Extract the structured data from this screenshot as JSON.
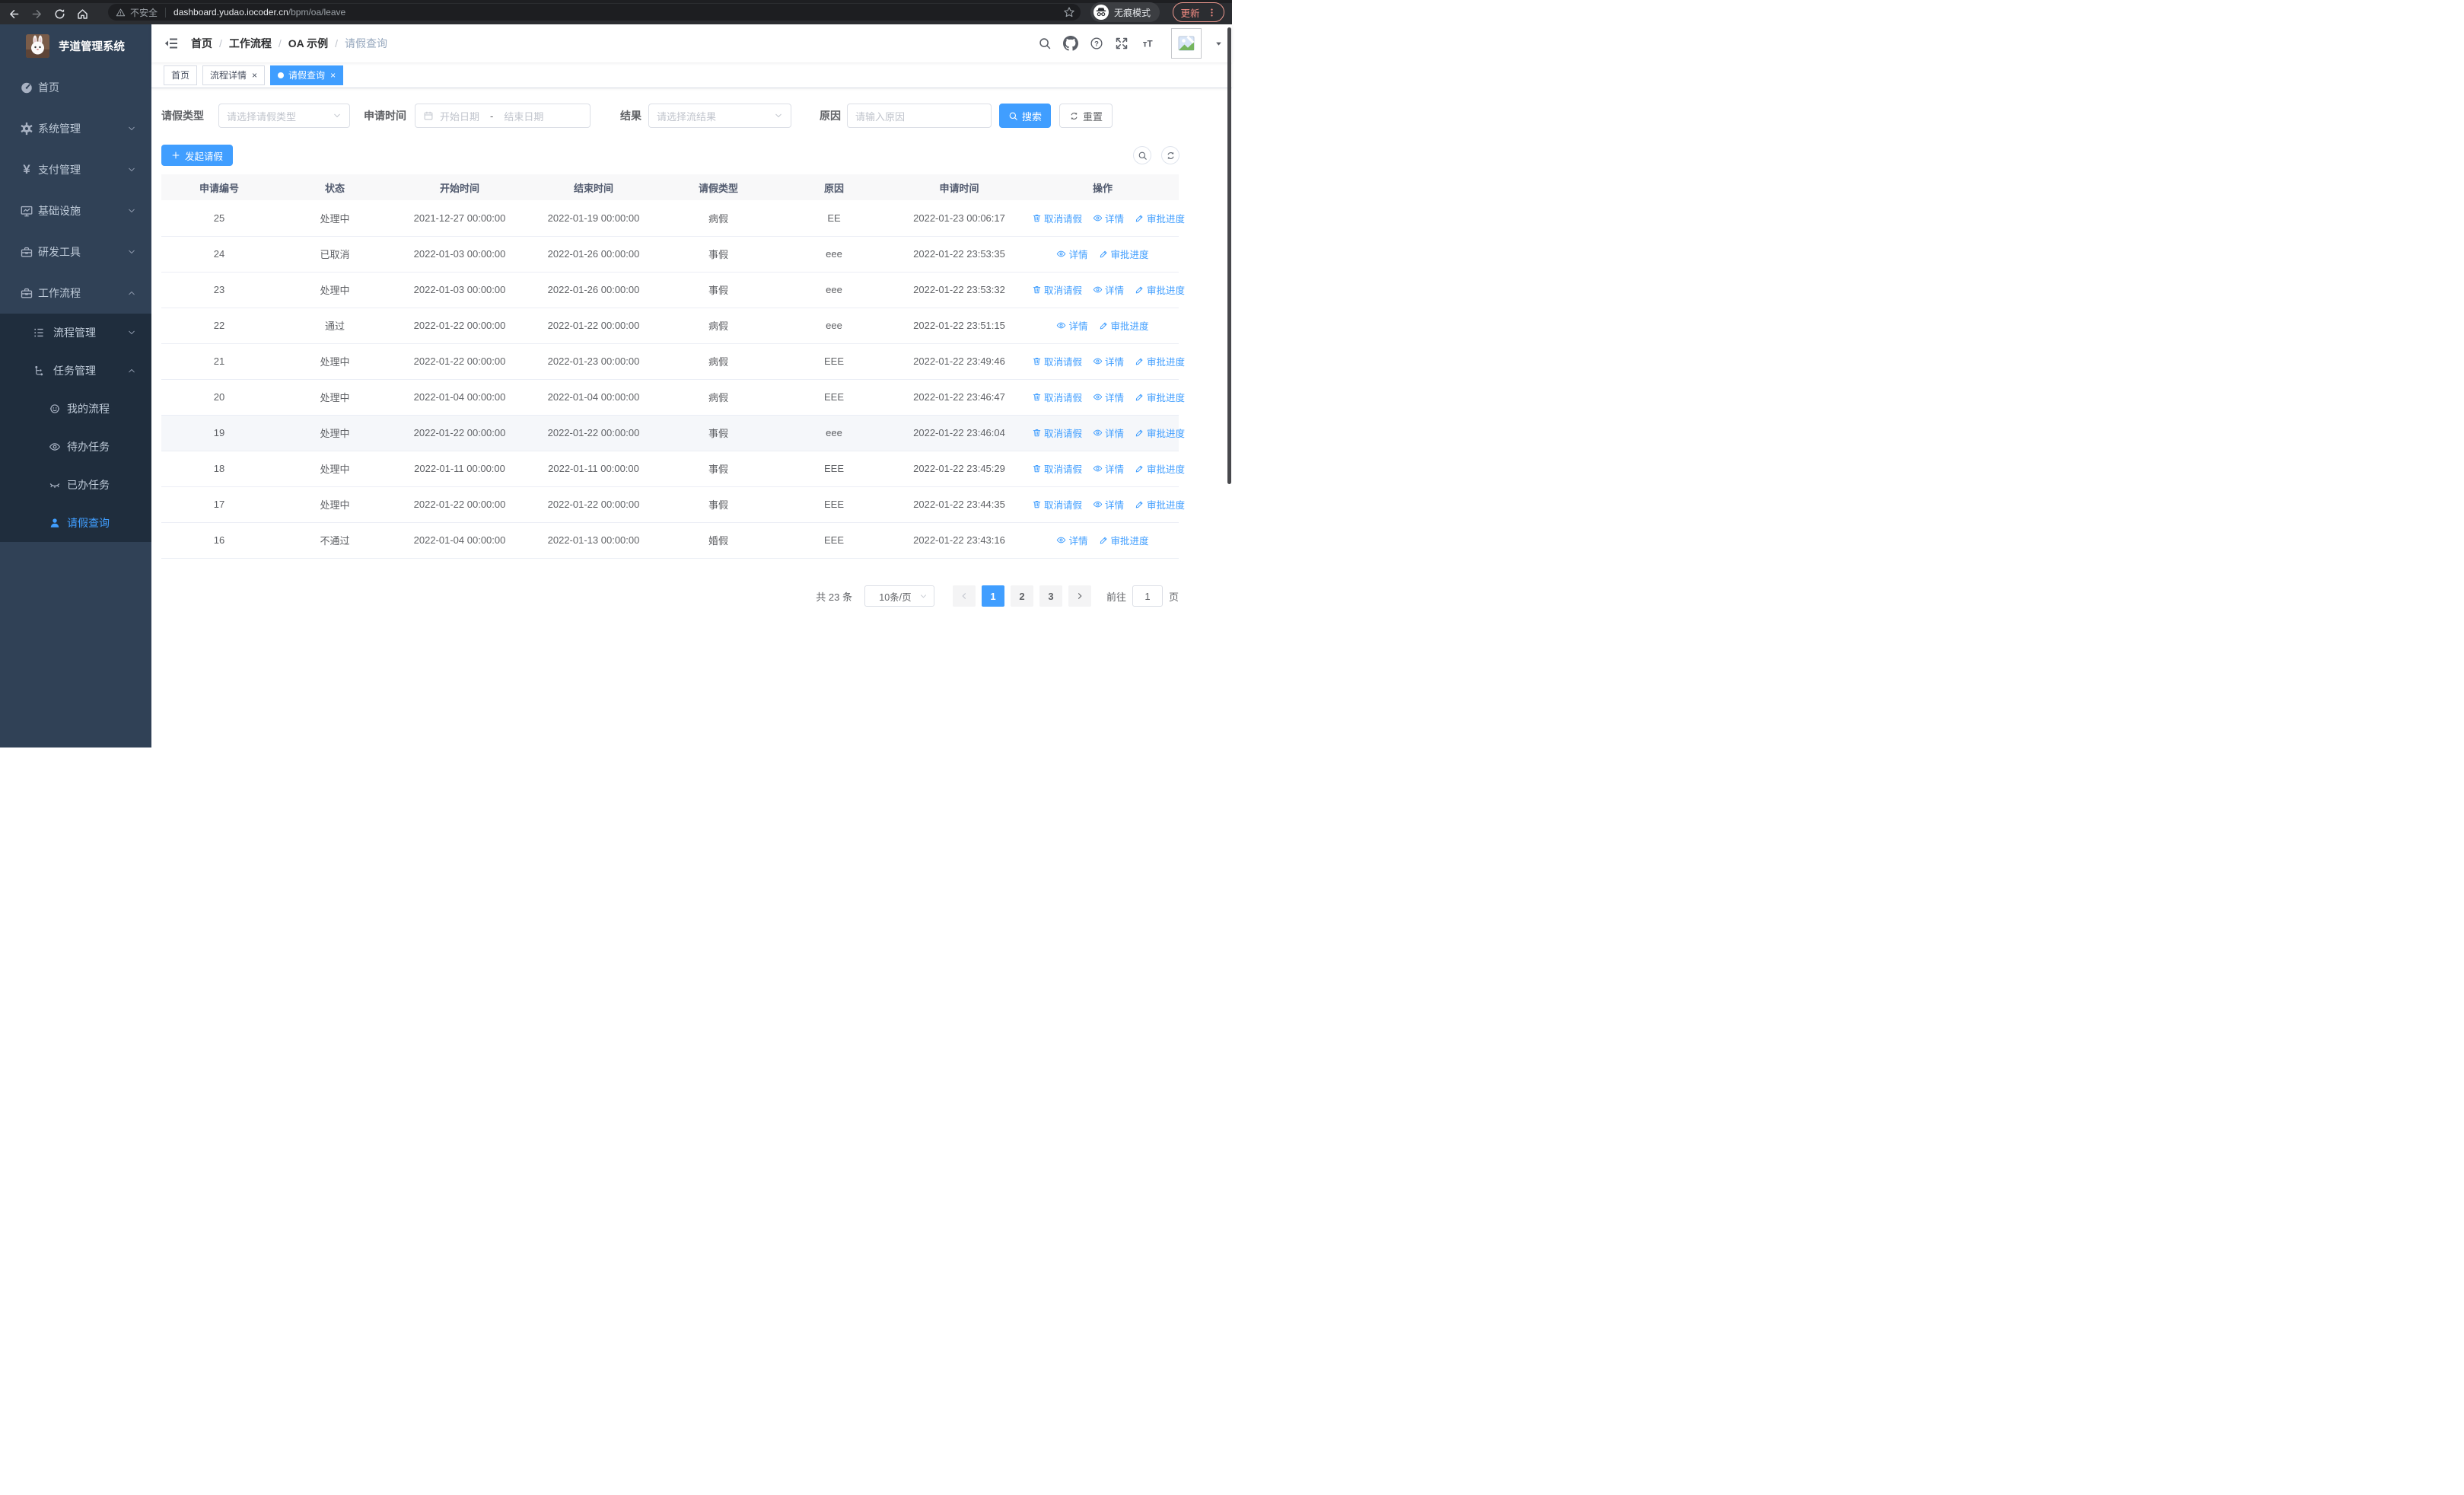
{
  "browser": {
    "security_label": "不安全",
    "url_host": "dashboard.yudao.iocoder.cn",
    "url_path": "/bpm/oa/leave",
    "incognito_label": "无痕模式",
    "update_label": "更新"
  },
  "sidebar": {
    "title": "芋道管理系统",
    "items": {
      "home": "首页",
      "system": "系统管理",
      "payment": "支付管理",
      "infra": "基础设施",
      "devtools": "研发工具",
      "workflow": "工作流程"
    },
    "workflow_children": {
      "process_mgmt": "流程管理",
      "task_mgmt": "任务管理"
    },
    "task_children": {
      "my_process": "我的流程",
      "todo_tasks": "待办任务",
      "done_tasks": "已办任务",
      "leave_query": "请假查询"
    }
  },
  "breadcrumb": {
    "separator": "/",
    "items": [
      "首页",
      "工作流程",
      "OA 示例",
      "请假查询"
    ]
  },
  "tabs": {
    "close_glyph": "×",
    "items": [
      "首页",
      "流程详情",
      "请假查询"
    ]
  },
  "filters": {
    "leave_type_label": "请假类型",
    "leave_type_placeholder": "请选择请假类型",
    "apply_time_label": "申请时间",
    "start_placeholder": "开始日期",
    "range_separator": "-",
    "end_placeholder": "结束日期",
    "result_label": "结果",
    "result_placeholder": "请选择流结果",
    "reason_label": "原因",
    "reason_placeholder": "请输入原因",
    "search_label": "搜索",
    "reset_label": "重置"
  },
  "toolbar": {
    "create_label": "发起请假"
  },
  "table": {
    "headers": [
      "申请编号",
      "状态",
      "开始时间",
      "结束时间",
      "请假类型",
      "原因",
      "申请时间",
      "操作"
    ],
    "ops": {
      "cancel": "取消请假",
      "detail": "详情",
      "progress": "审批进度"
    },
    "rows": [
      {
        "id": "25",
        "status": "处理中",
        "start": "2021-12-27 00:00:00",
        "end": "2022-01-19 00:00:00",
        "type": "病假",
        "reason": "EE",
        "apply": "2022-01-23 00:06:17"
      },
      {
        "id": "24",
        "status": "已取消",
        "start": "2022-01-03 00:00:00",
        "end": "2022-01-26 00:00:00",
        "type": "事假",
        "reason": "eee",
        "apply": "2022-01-22 23:53:35"
      },
      {
        "id": "23",
        "status": "处理中",
        "start": "2022-01-03 00:00:00",
        "end": "2022-01-26 00:00:00",
        "type": "事假",
        "reason": "eee",
        "apply": "2022-01-22 23:53:32"
      },
      {
        "id": "22",
        "status": "通过",
        "start": "2022-01-22 00:00:00",
        "end": "2022-01-22 00:00:00",
        "type": "病假",
        "reason": "eee",
        "apply": "2022-01-22 23:51:15"
      },
      {
        "id": "21",
        "status": "处理中",
        "start": "2022-01-22 00:00:00",
        "end": "2022-01-23 00:00:00",
        "type": "病假",
        "reason": "EEE",
        "apply": "2022-01-22 23:49:46"
      },
      {
        "id": "20",
        "status": "处理中",
        "start": "2022-01-04 00:00:00",
        "end": "2022-01-04 00:00:00",
        "type": "病假",
        "reason": "EEE",
        "apply": "2022-01-22 23:46:47"
      },
      {
        "id": "19",
        "status": "处理中",
        "start": "2022-01-22 00:00:00",
        "end": "2022-01-22 00:00:00",
        "type": "事假",
        "reason": "eee",
        "apply": "2022-01-22 23:46:04"
      },
      {
        "id": "18",
        "status": "处理中",
        "start": "2022-01-11 00:00:00",
        "end": "2022-01-11 00:00:00",
        "type": "事假",
        "reason": "EEE",
        "apply": "2022-01-22 23:45:29"
      },
      {
        "id": "17",
        "status": "处理中",
        "start": "2022-01-22 00:00:00",
        "end": "2022-01-22 00:00:00",
        "type": "事假",
        "reason": "EEE",
        "apply": "2022-01-22 23:44:35"
      },
      {
        "id": "16",
        "status": "不通过",
        "start": "2022-01-04 00:00:00",
        "end": "2022-01-13 00:00:00",
        "type": "婚假",
        "reason": "EEE",
        "apply": "2022-01-22 23:43:16"
      }
    ]
  },
  "pagination": {
    "total": "共 23 条",
    "page_size": "10条/页",
    "pages": [
      "1",
      "2",
      "3"
    ],
    "goto_label": "前往",
    "goto_value": "1",
    "page_suffix": "页"
  },
  "colors": {
    "accent": "#409eff",
    "sidebar_bg": "#304156",
    "submenu_bg": "#1f2d3d",
    "update_accent": "#f28b82"
  }
}
